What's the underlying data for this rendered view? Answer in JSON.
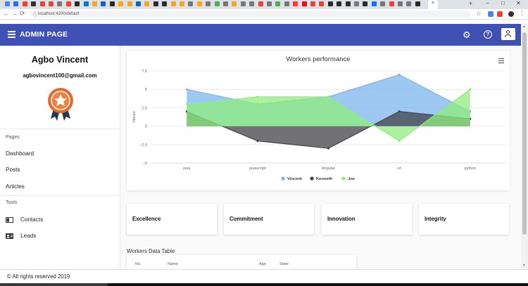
{
  "browser": {
    "url": "localhost:4200/default",
    "tab_colors": [
      "#4285f4",
      "#1a73e8",
      "#ea4335",
      "#333333",
      "#ea4335",
      "#ea4335",
      "#777777",
      "#ea4335",
      "#2b2b2b",
      "#0078d7",
      "#f5a623",
      "#0a66c2",
      "#2b2b2b",
      "#f5a623",
      "#f5a623",
      "#0a66c2",
      "#f5a623",
      "#2b2b2b",
      "#2b2b2b",
      "#f5a623",
      "#f5a623",
      "#777777",
      "#f5a623",
      "#777777",
      "#4caf50",
      "#777777",
      "#f5a623",
      "#777777",
      "#777777",
      "#ea4335",
      "#777777",
      "#4caf50",
      "#777777",
      "#ea4335",
      "#ff0000",
      "#ea4335",
      "#ea4335",
      "#2b2b2b",
      "#2b2b2b",
      "#2b2b2b",
      "#777777",
      "#2b2b2b",
      "#1a73e8",
      "#777777",
      "#ea4335",
      "#777777",
      "#777777",
      "#2b2b2b"
    ],
    "tab_close_icon": "×",
    "new_tab_icon": "+",
    "back_icon": "←",
    "forward_icon": "→",
    "reload_icon": "⟳",
    "info_icon": "ⓘ",
    "minimize_icon": "−",
    "maximize_icon": "□",
    "close_window_icon": "✕",
    "bookmark_icon": "☆"
  },
  "appbar": {
    "title": "ADMIN PAGE",
    "color": "#3f51b5",
    "settings_icon": "⚙",
    "help_icon": "?"
  },
  "sidebar": {
    "user_name": "Agbo Vincent",
    "user_email": "agbovincent100@gmail.com",
    "badge_icon": "award-ribbon-icon",
    "pages_title": "Pages",
    "pages": [
      {
        "label": "Dashboard"
      },
      {
        "label": "Posts"
      },
      {
        "label": "Articles"
      }
    ],
    "tools_title": "Tools",
    "tools": [
      {
        "label": "Contacts",
        "icon": "contacts-icon"
      },
      {
        "label": "Leads",
        "icon": "leads-icon"
      }
    ]
  },
  "chart_data": {
    "type": "area",
    "title": "Workers performance",
    "categories": [
      "java",
      "javascript",
      "Angular",
      "c#",
      "python"
    ],
    "ylabel": "Values",
    "xlabel": "",
    "ylim": [
      -5,
      7.5
    ],
    "yticks": [
      "7.5",
      "5",
      "2.5",
      "0",
      "−2.5",
      "−5"
    ],
    "grid": true,
    "legend_position": "bottom",
    "series": [
      {
        "name": "Vincent",
        "values": [
          5,
          3,
          4,
          7,
          2
        ],
        "color": "#7cb5ec"
      },
      {
        "name": "Kenneth",
        "values": [
          2,
          -2,
          -3,
          2,
          1
        ],
        "color": "#434348"
      },
      {
        "name": "Joe",
        "values": [
          3,
          4,
          4,
          -2,
          5
        ],
        "color": "#90ed7d"
      }
    ]
  },
  "cards": [
    {
      "label": "Excellence"
    },
    {
      "label": "Commitment"
    },
    {
      "label": "Innovation"
    },
    {
      "label": "Integrity"
    }
  ],
  "table": {
    "title": "Workers Data Table",
    "headers": [
      "No.",
      "Name",
      "Age",
      "State"
    ]
  },
  "footer": {
    "text": "© All rights reserved 2019"
  }
}
